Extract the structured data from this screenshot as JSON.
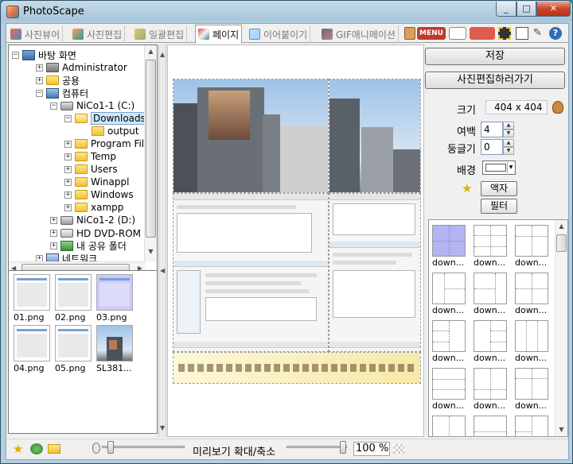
{
  "window": {
    "title": "PhotoScape",
    "min": "_",
    "max": "□",
    "close": "✕"
  },
  "tabs": [
    {
      "label": "사진뷰어",
      "active": false
    },
    {
      "label": "사진편집",
      "active": false
    },
    {
      "label": "일괄편집",
      "active": false
    },
    {
      "label": "페이지",
      "active": true
    },
    {
      "label": "이어붙이기",
      "active": false
    },
    {
      "label": "GIF애니메이션",
      "active": false
    }
  ],
  "toolbar_icons": [
    "menu-icon",
    "window-icon",
    "sign-icon",
    "film-icon",
    "copy-icon",
    "tools-icon",
    "help-icon"
  ],
  "toolbar": {
    "menu_label": "MENU"
  },
  "tree": {
    "nodes": [
      {
        "label": "바탕 화면"
      },
      {
        "label": "Administrator"
      },
      {
        "label": "공용"
      },
      {
        "label": "컴퓨터"
      },
      {
        "label": "NiCo1-1 (C:)"
      },
      {
        "label": "Downloads"
      },
      {
        "label": "output"
      },
      {
        "label": "Program Files"
      },
      {
        "label": "Temp"
      },
      {
        "label": "Users"
      },
      {
        "label": "Winappl"
      },
      {
        "label": "Windows"
      },
      {
        "label": "xampp"
      },
      {
        "label": "NiCo1-2 (D:)"
      },
      {
        "label": "HD DVD-ROM 드"
      },
      {
        "label": "내 공유 폴더"
      },
      {
        "label": "네트워크"
      }
    ]
  },
  "files": [
    {
      "name": "01.png"
    },
    {
      "name": "02.png"
    },
    {
      "name": "03.png"
    },
    {
      "name": "04.png"
    },
    {
      "name": "05.png"
    },
    {
      "name": "SL381..."
    }
  ],
  "right": {
    "save_label": "저장",
    "edit_label": "사진편집하러가기",
    "size_label": "크기",
    "size_value": "404 x 404",
    "margin_label": "여백",
    "margin_value": "4",
    "round_label": "둥글기",
    "round_value": "0",
    "bg_label": "배경",
    "frame_label": "액자",
    "filter_label": "필터"
  },
  "frames": [
    {
      "name": "down..."
    },
    {
      "name": "down..."
    },
    {
      "name": "down..."
    },
    {
      "name": "down..."
    },
    {
      "name": "down..."
    },
    {
      "name": "down..."
    },
    {
      "name": "down..."
    },
    {
      "name": "down..."
    },
    {
      "name": "down..."
    },
    {
      "name": "down..."
    },
    {
      "name": "down..."
    },
    {
      "name": "down..."
    },
    {
      "name": "down..."
    },
    {
      "name": "down..."
    },
    {
      "name": "down..."
    }
  ],
  "bottom": {
    "zoom_label": "미리보기 확대/축소",
    "zoom_value": "100 %"
  },
  "colors": {
    "accent": "#cde8ff",
    "selected_thumb": "#c9c9ff",
    "selected_frame": "#b4b4f4",
    "title_bar": "#a8c6da",
    "close": "#c8442a"
  }
}
